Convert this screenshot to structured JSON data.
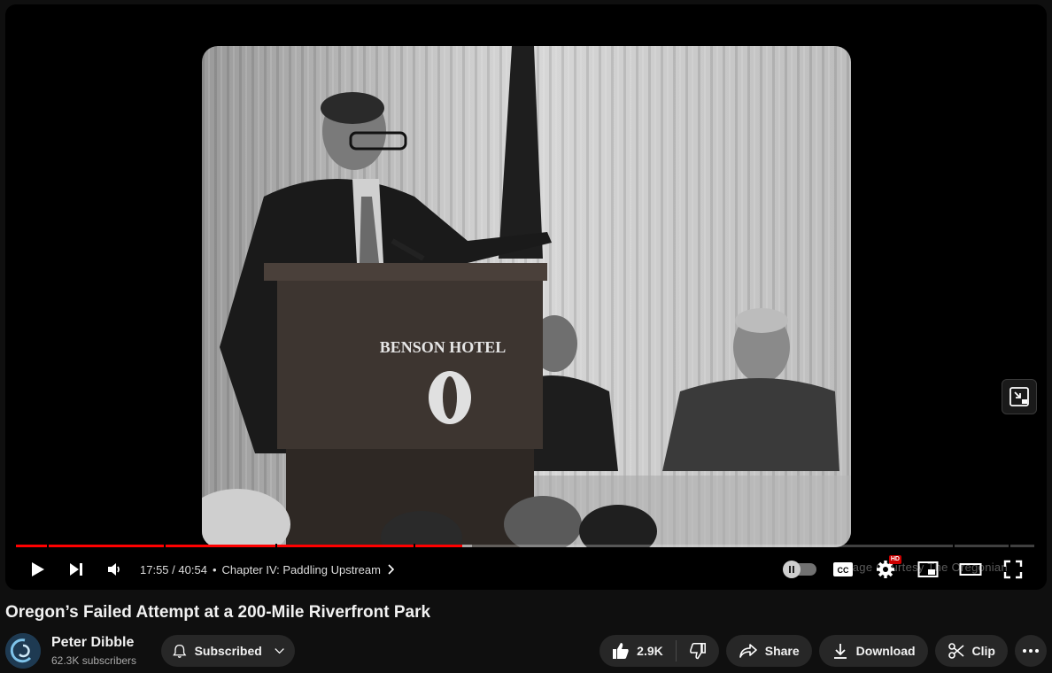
{
  "player": {
    "current_time": "17:55",
    "duration": "40:54",
    "separator": " / ",
    "chapter": "Chapter IV: Paddling Upstream",
    "watermark": "Image Courtesy The Oregonian",
    "played_fraction": 0.438,
    "buffered_fraction": 0.448,
    "chapter_marks": [
      0.03,
      0.145,
      0.255,
      0.39,
      0.92,
      0.975
    ],
    "hd_badge": "HD",
    "podium_sign": "BENSON HOTEL"
  },
  "video": {
    "title": "Oregon’s Failed Attempt at a 200-Mile Riverfront Park"
  },
  "channel": {
    "name": "Peter Dibble",
    "subscribers": "62.3K subscribers",
    "subscribe_label": "Subscribed"
  },
  "actions": {
    "likes": "2.9K",
    "share": "Share",
    "download": "Download",
    "clip": "Clip"
  },
  "colors": {
    "progress_played": "#ff0000",
    "background": "#0f0f0f",
    "pill": "#272727"
  }
}
